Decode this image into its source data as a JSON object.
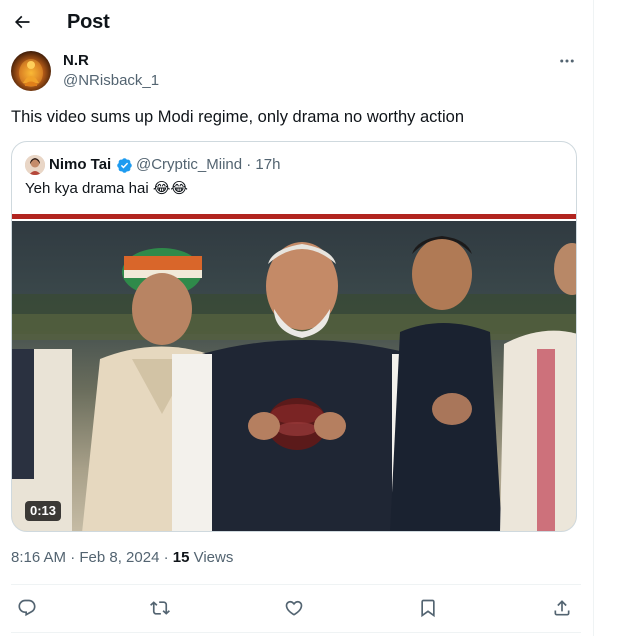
{
  "header": {
    "title": "Post"
  },
  "post": {
    "author_name": "N.R",
    "author_handle": "@NRisback_1",
    "text": "This video sums up Modi regime, only drama no worthy action",
    "timestamp": "8:16 AM · Feb 8, 2024 · ",
    "views_count": "15",
    "views_label": " Views"
  },
  "quote": {
    "author_name": "Nimo Tai",
    "handle_time": "@Cryptic_Miind · 17h",
    "text": "Yeh kya drama hai 😂😂",
    "video_duration": "0:13"
  },
  "icons": {
    "back": "arrow-left-icon",
    "more": "more-horizontal-icon",
    "verified": "verified-badge-icon",
    "reply": "reply-icon",
    "repost": "repost-icon",
    "like": "heart-icon",
    "bookmark": "bookmark-icon",
    "share": "share-icon"
  },
  "colors": {
    "text_primary": "#0f1419",
    "text_secondary": "#536471",
    "verified_blue": "#1d9bf0",
    "border": "#cfd9de",
    "divider": "#eff3f4"
  }
}
